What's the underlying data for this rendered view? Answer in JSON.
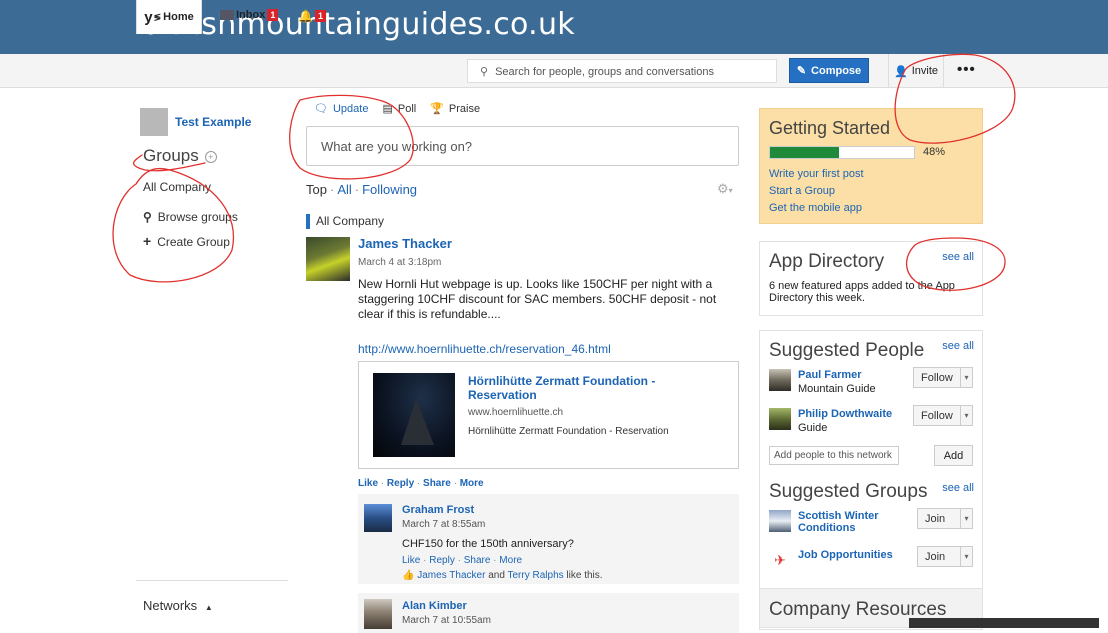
{
  "banner": {
    "title": "britishmountainguides.co.uk"
  },
  "nav": {
    "home_logo": "y",
    "home_label": "Home",
    "inbox_label": "Inbox",
    "inbox_count": "1",
    "notif_count": "1",
    "search_placeholder": "Search for people, groups and conversations",
    "compose_label": "Compose",
    "invite_label": "Invite",
    "more_label": "•••"
  },
  "left": {
    "user_name": "Test Example",
    "groups_heading": "Groups",
    "all_company": "All Company",
    "browse_groups": "Browse groups",
    "create_group": "Create Group",
    "networks": "Networks"
  },
  "publisher": {
    "tabs": [
      "Update",
      "Poll",
      "Praise"
    ],
    "placeholder": "What are you working on?"
  },
  "feed": {
    "filter": {
      "top": "Top",
      "all": "All",
      "following": "Following"
    },
    "group_label": "All Company",
    "post": {
      "author": "James Thacker",
      "time": "March 4 at 3:18pm",
      "body": "New Hornli Hut webpage is up. Looks like 150CHF per night with a staggering 10CHF discount for SAC members. 50CHF deposit - not clear if this is refundable....",
      "link": "http://www.hoernlihuette.ch/reservation_46.html",
      "attachment": {
        "title": "Hörnlihütte Zermatt Foundation - Reservation",
        "domain": "www.hoernlihuette.ch",
        "description": "Hörnlihütte Zermatt Foundation - Reservation"
      },
      "actions": [
        "Like",
        "Reply",
        "Share",
        "More"
      ]
    },
    "replies": [
      {
        "author": "Graham Frost",
        "time": "March 7 at 8:55am",
        "text": "CHF150 for the 150th anniversary?",
        "actions": [
          "Like",
          "Reply",
          "Share",
          "More"
        ],
        "likers": [
          "James Thacker",
          "Terry Ralphs"
        ],
        "likes_and": "and",
        "likes_suffix": "like this."
      },
      {
        "author": "Alan Kimber",
        "time": "March 7 at 10:55am"
      }
    ]
  },
  "right": {
    "getting_started": {
      "title": "Getting Started",
      "progress_percent": 48,
      "progress_label": "48%",
      "links": [
        "Write your first post",
        "Start a Group",
        "Get the mobile app"
      ]
    },
    "app_directory": {
      "title": "App Directory",
      "see_all": "see all",
      "description": "6 new featured apps added to the App Directory this week."
    },
    "suggested_people": {
      "title": "Suggested People",
      "see_all": "see all",
      "people": [
        {
          "name": "Paul Farmer",
          "role": "Mountain Guide",
          "button": "Follow"
        },
        {
          "name": "Philip Dowthwaite",
          "role": "Guide",
          "button": "Follow"
        }
      ],
      "add_placeholder": "Add people to this network",
      "add_button": "Add"
    },
    "suggested_groups": {
      "title": "Suggested Groups",
      "see_all": "see all",
      "groups": [
        {
          "name": "Scottish Winter Conditions",
          "button": "Join"
        },
        {
          "name": "Job Opportunities",
          "button": "Join"
        }
      ]
    },
    "company_resources": {
      "title": "Company Resources"
    }
  },
  "colors": {
    "banner": "#3c6c96",
    "link": "#1c64b4",
    "compose": "#2570c2",
    "getting_started_bg": "#fbdfa6",
    "progress": "#1f8a3a",
    "annotation_red": "#e0312e",
    "badge": "#d8232a"
  }
}
